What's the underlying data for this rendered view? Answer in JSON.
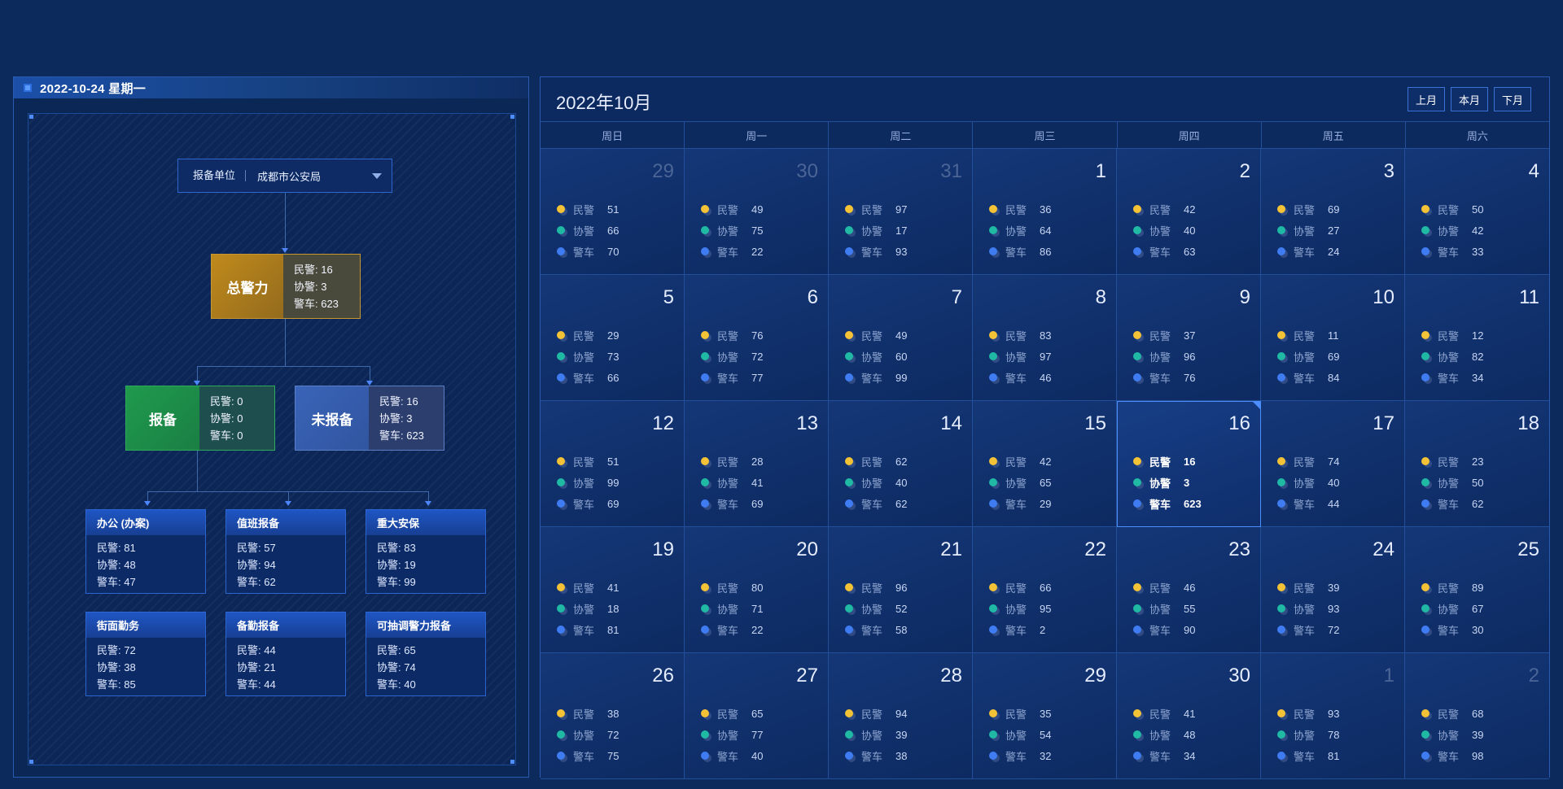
{
  "left": {
    "date_title": "2022-10-24 星期一",
    "unit_label": "报备单位",
    "unit_value": "成都市公安局",
    "total": {
      "name": "总警力",
      "lines": [
        "民警: 16",
        "协警: 3",
        "警车: 623"
      ]
    },
    "reported": {
      "name": "报备",
      "lines": [
        "民警: 0",
        "协警: 0",
        "警车: 0"
      ]
    },
    "unreported": {
      "name": "未报备",
      "lines": [
        "民警: 16",
        "协警: 3",
        "警车: 623"
      ]
    },
    "categories": [
      {
        "title": "办公 (办案)",
        "lines": [
          "民警: 81",
          "协警: 48",
          "警车: 47"
        ]
      },
      {
        "title": "值班报备",
        "lines": [
          "民警: 57",
          "协警: 94",
          "警车: 62"
        ]
      },
      {
        "title": "重大安保",
        "lines": [
          "民警: 83",
          "协警: 19",
          "警车: 99"
        ]
      },
      {
        "title": "街面勤务",
        "lines": [
          "民警: 72",
          "协警: 38",
          "警车: 85"
        ]
      },
      {
        "title": "备勤报备",
        "lines": [
          "民警: 44",
          "协警: 21",
          "警车: 44"
        ]
      },
      {
        "title": "可抽调警力报备",
        "lines": [
          "民警: 65",
          "协警: 74",
          "警车: 40"
        ]
      }
    ]
  },
  "calendar": {
    "title": "2022年10月",
    "buttons": {
      "prev": "上月",
      "current": "本月",
      "next": "下月"
    },
    "weekdays": [
      "周日",
      "周一",
      "周二",
      "周三",
      "周四",
      "周五",
      "周六"
    ],
    "stat_labels": [
      "民警",
      "协警",
      "警车"
    ],
    "colors": {
      "police": "#f3c236",
      "auxiliary": "#1fb9a4",
      "vehicle": "#3f7cf2"
    },
    "days": [
      {
        "day": "29",
        "other": true,
        "v": [
          "51",
          "66",
          "70"
        ]
      },
      {
        "day": "30",
        "other": true,
        "v": [
          "49",
          "75",
          "22"
        ]
      },
      {
        "day": "31",
        "other": true,
        "v": [
          "97",
          "17",
          "93"
        ]
      },
      {
        "day": "1",
        "v": [
          "36",
          "64",
          "86"
        ]
      },
      {
        "day": "2",
        "v": [
          "42",
          "40",
          "63"
        ]
      },
      {
        "day": "3",
        "v": [
          "69",
          "27",
          "24"
        ]
      },
      {
        "day": "4",
        "v": [
          "50",
          "42",
          "33"
        ]
      },
      {
        "day": "5",
        "v": [
          "29",
          "73",
          "66"
        ]
      },
      {
        "day": "6",
        "v": [
          "76",
          "72",
          "77"
        ]
      },
      {
        "day": "7",
        "v": [
          "49",
          "60",
          "99"
        ]
      },
      {
        "day": "8",
        "v": [
          "83",
          "97",
          "46"
        ]
      },
      {
        "day": "9",
        "v": [
          "37",
          "96",
          "76"
        ]
      },
      {
        "day": "10",
        "v": [
          "11",
          "69",
          "84"
        ]
      },
      {
        "day": "11",
        "v": [
          "12",
          "82",
          "34"
        ]
      },
      {
        "day": "12",
        "v": [
          "51",
          "99",
          "69"
        ]
      },
      {
        "day": "13",
        "v": [
          "28",
          "41",
          "69"
        ]
      },
      {
        "day": "14",
        "v": [
          "62",
          "40",
          "62"
        ]
      },
      {
        "day": "15",
        "v": [
          "42",
          "65",
          "29"
        ]
      },
      {
        "day": "16",
        "selected": true,
        "v": [
          "16",
          "3",
          "623"
        ]
      },
      {
        "day": "17",
        "v": [
          "74",
          "40",
          "44"
        ]
      },
      {
        "day": "18",
        "v": [
          "23",
          "50",
          "62"
        ]
      },
      {
        "day": "19",
        "v": [
          "41",
          "18",
          "81"
        ]
      },
      {
        "day": "20",
        "v": [
          "80",
          "71",
          "22"
        ]
      },
      {
        "day": "21",
        "v": [
          "96",
          "52",
          "58"
        ]
      },
      {
        "day": "22",
        "v": [
          "66",
          "95",
          "2"
        ]
      },
      {
        "day": "23",
        "v": [
          "46",
          "55",
          "90"
        ]
      },
      {
        "day": "24",
        "v": [
          "39",
          "93",
          "72"
        ]
      },
      {
        "day": "25",
        "v": [
          "89",
          "67",
          "30"
        ]
      },
      {
        "day": "26",
        "v": [
          "38",
          "72",
          "75"
        ]
      },
      {
        "day": "27",
        "v": [
          "65",
          "77",
          "40"
        ]
      },
      {
        "day": "28",
        "v": [
          "94",
          "39",
          "38"
        ]
      },
      {
        "day": "29",
        "v": [
          "35",
          "54",
          "32"
        ]
      },
      {
        "day": "30",
        "v": [
          "41",
          "48",
          "34"
        ]
      },
      {
        "day": "1",
        "other": true,
        "v": [
          "93",
          "78",
          "81"
        ]
      },
      {
        "day": "2",
        "other": true,
        "v": [
          "68",
          "39",
          "98"
        ]
      }
    ]
  }
}
